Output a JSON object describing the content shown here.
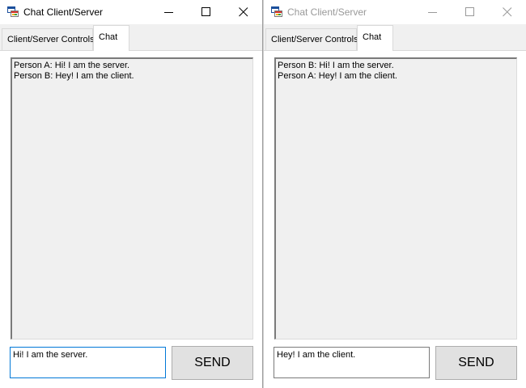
{
  "windows": [
    {
      "title": "Chat Client/Server",
      "tabs": [
        {
          "label": "Client/Server Controls"
        },
        {
          "label": "Chat"
        }
      ],
      "chat_log": [
        "Person A: Hi! I am the server.",
        "Person B: Hey! I am the client."
      ],
      "message_input": {
        "value": "Hi! I am the server."
      },
      "send_label": "SEND"
    },
    {
      "title": "Chat Client/Server",
      "tabs": [
        {
          "label": "Client/Server Controls"
        },
        {
          "label": "Chat"
        }
      ],
      "chat_log": [
        "Person B: Hi! I am the server.",
        "Person A: Hey! I am the client."
      ],
      "message_input": {
        "value": "Hey! I am the client."
      },
      "send_label": "SEND"
    }
  ],
  "icons": {
    "app": "app-icon",
    "minimize": "minimize-icon",
    "maximize": "maximize-icon",
    "close": "close-icon"
  },
  "colors": {
    "active_input_border": "#0078d7",
    "inactive_title_text": "#999999",
    "control_face": "#e1e1e1",
    "log_background": "#f0f0f0"
  }
}
